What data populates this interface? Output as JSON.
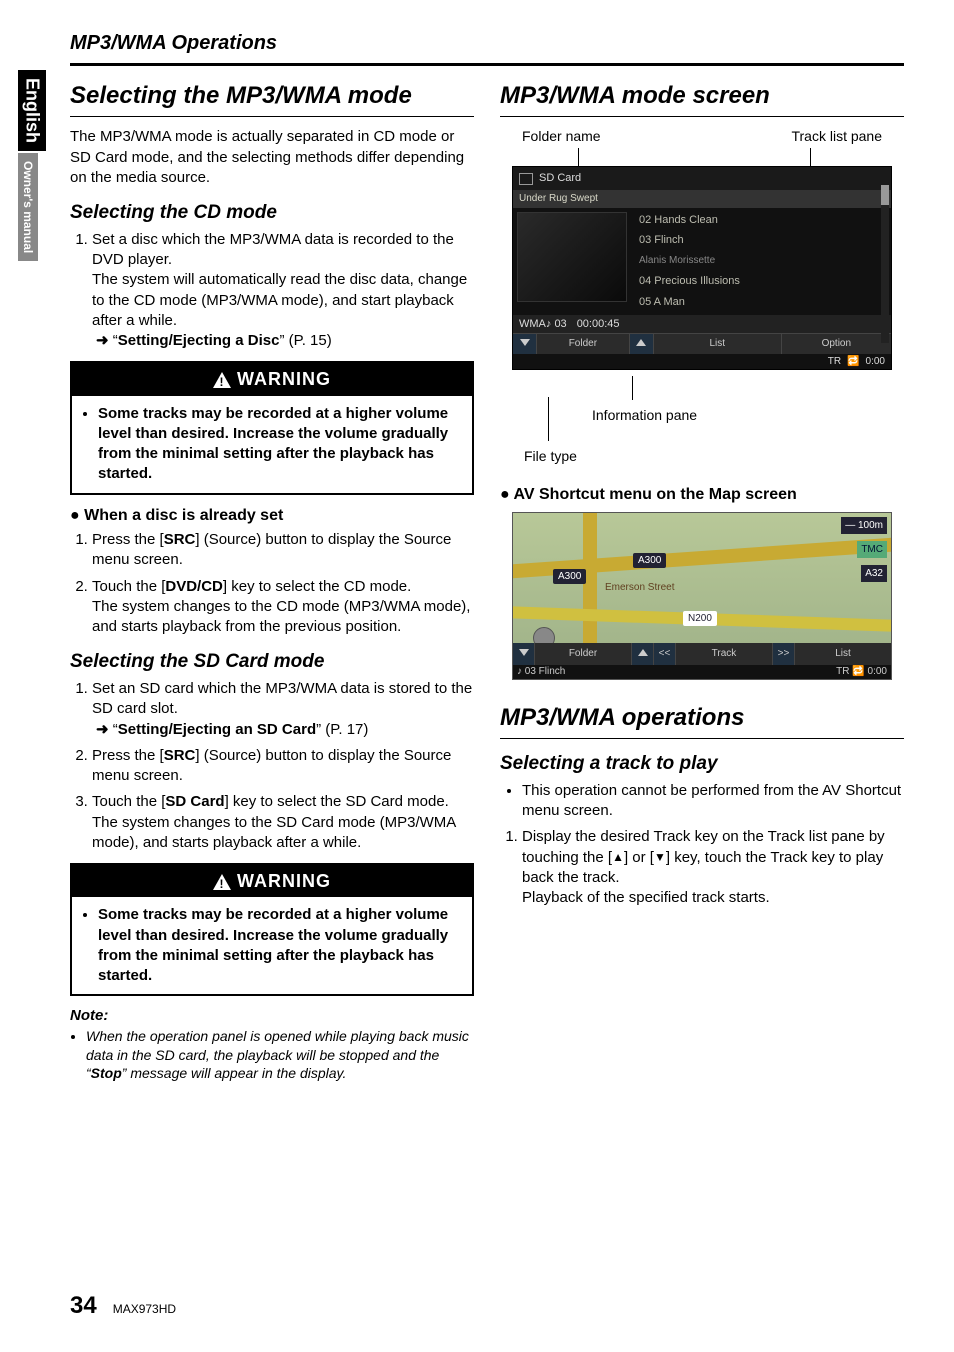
{
  "side": {
    "tab1": "English",
    "tab2": "Owner's manual"
  },
  "header": "MP3/WMA Operations",
  "left": {
    "h1": "Selecting the MP3/WMA mode",
    "intro": "The MP3/WMA mode is actually separated in CD mode or SD Card mode, and the selecting methods differ depending on the media source.",
    "cd": {
      "title": "Selecting the CD mode",
      "step1a": "Set a disc which the MP3/WMA data is recorded to the DVD player.",
      "step1b": "The system will automatically read the disc data, change to the CD mode (MP3/WMA mode), and start playback after a while.",
      "ref_arrow": "➜",
      "ref": "\"Setting/Ejecting a Disc\" (P. 15)"
    },
    "warn_label": "WARNING",
    "warn1": "Some tracks may be recorded at a higher volume level than desired. Increase the volume gradually from the minimal setting after the playback has started.",
    "already": {
      "title": "When a disc is already set",
      "s1a": "Press the [",
      "s1b": "SRC",
      "s1c": "] (Source) button to display the Source menu screen.",
      "s2a": "Touch the [",
      "s2b": "DVD/CD",
      "s2c": "] key to select the CD mode.",
      "s2d": "The system changes to the CD mode (MP3/WMA mode), and starts playback from the previous position."
    },
    "sd": {
      "title": "Selecting the SD Card mode",
      "s1": "Set an SD card which the MP3/WMA data is stored to the SD card slot.",
      "ref_arrow": "➜",
      "ref": "\"Setting/Ejecting an SD Card\" (P. 17)",
      "s2a": "Press the [",
      "s2b": "SRC",
      "s2c": "] (Source) button to display the Source menu screen.",
      "s3a": "Touch the [",
      "s3b": "SD Card",
      "s3c": "] key to select the SD Card mode.",
      "s3d": "The system changes to the SD Card mode (MP3/WMA mode), and starts playback after a while."
    },
    "warn2": "Some tracks may be recorded at a higher volume level than desired. Increase the volume gradually from the minimal setting after the playback has started.",
    "note_label": "Note:",
    "note": "When the operation panel is opened while playing back music data in the SD card, the playback will be stopped and the \"Stop\" message will appear in the display.",
    "note_stop_word": "Stop"
  },
  "right": {
    "h1": "MP3/WMA mode screen",
    "labels": {
      "folder": "Folder name",
      "tracklist": "Track list pane",
      "info": "Information pane",
      "filetype": "File type"
    },
    "shot1": {
      "source": "SD Card",
      "folder": "Under Rug Swept",
      "rows": [
        "02 Hands Clean",
        "03 Flinch",
        "      Alanis Morissette",
        "04 Precious Illusions",
        "05 A Man"
      ],
      "info_track": "WMA♪ 03",
      "info_time": "00:00:45",
      "bot": {
        "folder": "Folder",
        "list": "List",
        "option": "Option"
      },
      "footer_tr": "TR",
      "footer_time": "0:00"
    },
    "avhead": "AV Shortcut menu on the Map screen",
    "map": {
      "scale": "100m",
      "tmc": "TMC",
      "a32": "A32",
      "a300a": "A300",
      "a300b": "A300",
      "n200": "N200",
      "street": "Emerson Street",
      "bot": [
        "Folder",
        "Track",
        "List"
      ],
      "status_left": "♪ 03 Flinch",
      "status_tr": "TR",
      "status_time": "0:00"
    },
    "ops": {
      "h1": "MP3/WMA operations",
      "sel": "Selecting a track to play",
      "bullet": "This operation cannot be performed from the AV Shortcut menu screen.",
      "s1a": "Display the desired Track key on the Track list pane by touching the [",
      "s1b": "] or [",
      "s1c": "] key, touch the Track key to play back the track.",
      "s1d": "Playback of the specified track starts."
    }
  },
  "footer": {
    "page": "34",
    "model": "MAX973HD"
  }
}
